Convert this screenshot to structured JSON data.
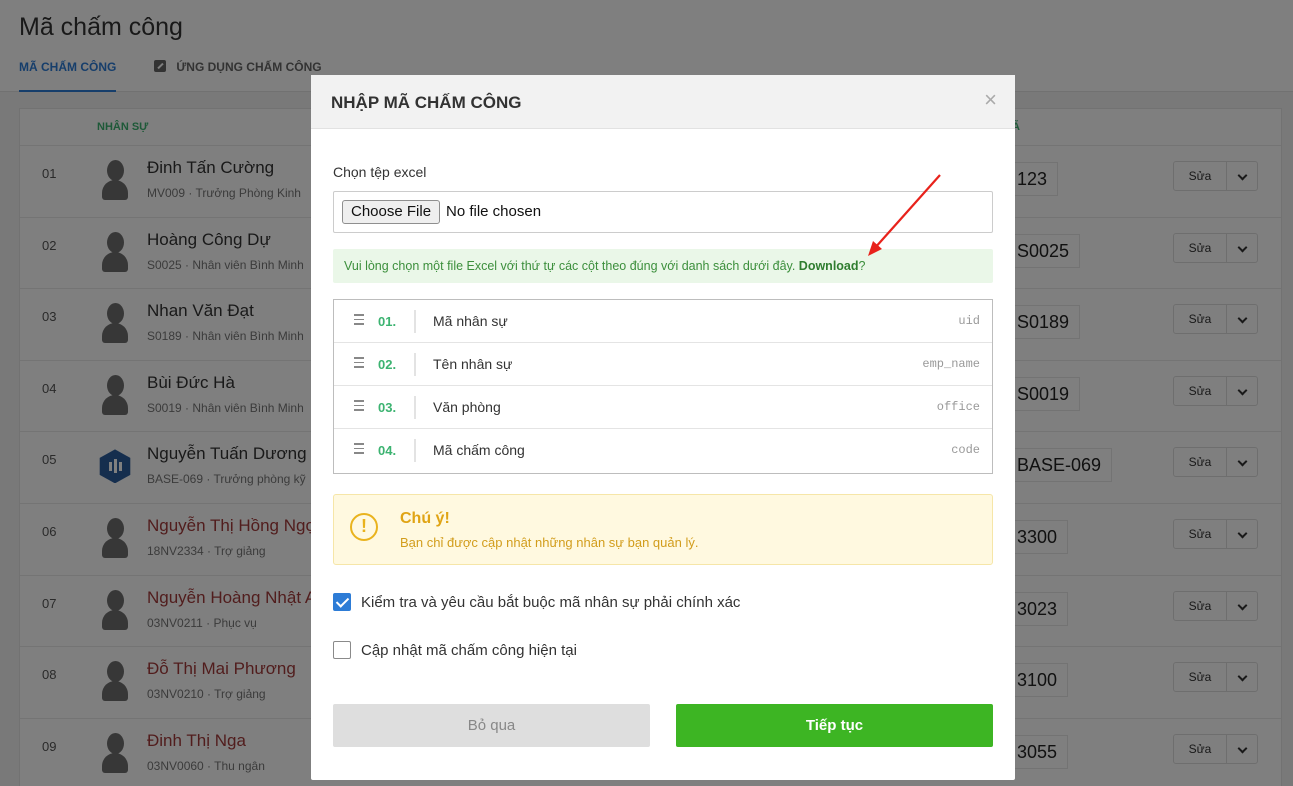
{
  "page": {
    "title": "Mã chấm công",
    "tabs": [
      {
        "label": "MÃ CHẤM CÔNG"
      },
      {
        "label": "ỨNG DỤNG CHẤM CÔNG"
      }
    ]
  },
  "table": {
    "header_staff": "NHÂN SỰ",
    "header_code": "Ã",
    "edit_label": "Sửa",
    "rows": [
      {
        "idx": "01",
        "name": "Đinh Tấn Cường",
        "sub": "MV009 · Trưởng Phòng Kinh",
        "code": "123"
      },
      {
        "idx": "02",
        "name": "Hoàng Công Dự",
        "sub": "S0025 · Nhân viên Bình Minh",
        "code": "S0025"
      },
      {
        "idx": "03",
        "name": "Nhan Văn Đạt",
        "sub": "S0189 · Nhân viên Bình Minh",
        "code": "S0189"
      },
      {
        "idx": "04",
        "name": "Bùi Đức Hà",
        "sub": "S0019 · Nhân viên Bình Minh",
        "code": "S0019"
      },
      {
        "idx": "05",
        "name": "Nguyễn Tuấn Dương",
        "sub": "BASE-069 · Trưởng phòng kỹ",
        "code": "BASE-069"
      },
      {
        "idx": "06",
        "name": "Nguyễn Thị Hồng Ngọc",
        "sub": "18NV2334 · Trợ giảng",
        "code": "3300"
      },
      {
        "idx": "07",
        "name": "Nguyễn Hoàng Nhật A",
        "sub": "03NV0211 · Phục vụ",
        "code": "3023"
      },
      {
        "idx": "08",
        "name": "Đỗ Thị Mai Phương",
        "sub": "03NV0210 · Trợ giảng",
        "code": "3100"
      },
      {
        "idx": "09",
        "name": "Đinh Thị Nga",
        "sub": "03NV0060 · Thu ngân",
        "code": "3055"
      }
    ]
  },
  "modal": {
    "title": "NHẬP MÃ CHẤM CÔNG",
    "close": "×",
    "file_label": "Chọn tệp excel",
    "file_button": "Choose File",
    "file_state": "No file chosen",
    "hint_text": "Vui lòng chọn một file Excel với thứ tự các cột theo đúng với danh sách dưới đây. ",
    "hint_link": "Download",
    "hint_end": "?",
    "columns": [
      {
        "num": "01.",
        "name": "Mã nhân sự",
        "key": "uid"
      },
      {
        "num": "02.",
        "name": "Tên nhân sự",
        "key": "emp_name"
      },
      {
        "num": "03.",
        "name": "Văn phòng",
        "key": "office"
      },
      {
        "num": "04.",
        "name": "Mã chấm công",
        "key": "code"
      }
    ],
    "notice_icon": "!",
    "notice_title": "Chú ý!",
    "notice_text": "Bạn chỉ được cập nhật những nhân sự bạn quản lý.",
    "check1_label": "Kiểm tra và yêu cầu bắt buộc mã nhân sự phải chính xác",
    "check1_checked": true,
    "check2_label": "Cập nhật mã chấm công hiện tại",
    "check2_checked": false,
    "skip_button": "Bỏ qua",
    "next_button": "Tiếp tục"
  },
  "colors": {
    "accent": "#2d7cd6",
    "success": "#3db523",
    "warning": "#e0a414",
    "annotation_arrow": "#e8221b"
  }
}
